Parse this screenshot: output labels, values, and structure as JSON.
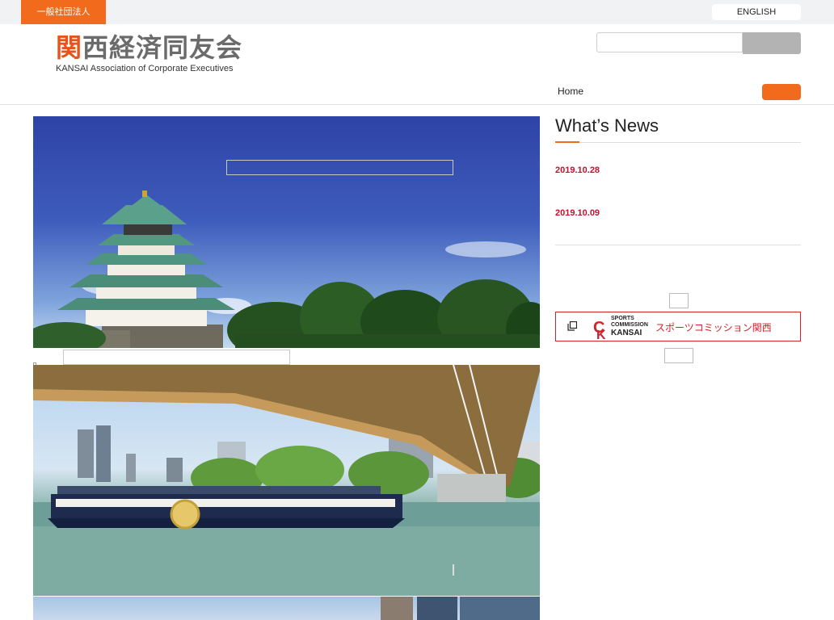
{
  "topbar": {
    "corp_tag": "一般社団法人",
    "english_label": "ENGLISH"
  },
  "logo": {
    "jp_accent": "関",
    "jp_rest": "西経済同友会",
    "en": "KANSAI Association of Corporate Executives"
  },
  "search": {
    "placeholder": "",
    "button_label": ""
  },
  "nav": {
    "home": "Home",
    "menu_label": ""
  },
  "news": {
    "title": "What’s News",
    "items": [
      {
        "date": "2019.10.28"
      },
      {
        "date": "2019.10.09"
      }
    ]
  },
  "banner": {
    "logo_line1": "SPORTS",
    "logo_line2": "COMMISSION",
    "logo_line3": "KANSAI",
    "text": "スポーツコミッション関西"
  },
  "colors": {
    "accent": "#f26b1d",
    "date_red": "#c8102e",
    "banner_red": "#d2232a"
  }
}
